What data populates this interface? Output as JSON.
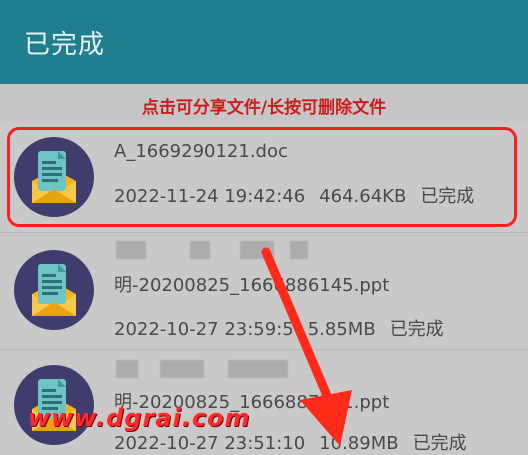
{
  "header": {
    "title": "已完成"
  },
  "hint": {
    "text": "点击可分享文件/长按可删除文件"
  },
  "files": [
    {
      "name": "A_1669290121.doc",
      "date": "2022-11-24 19:42:46",
      "size": "464.64KB",
      "status": "已完成"
    },
    {
      "name": "明-20200825_1666886145.ppt",
      "date": "2022-10-27 23:59:5",
      "size": "5.85MB",
      "status": "已完成"
    },
    {
      "name": "明-20200825_1666887191.ppt",
      "date": "2022-10-27 23:51:10",
      "size": "10.89MB",
      "status": "已完成"
    }
  ],
  "watermark": "www.dgrai.com",
  "colors": {
    "appbar": "#1f7f8f",
    "hint_text": "#c81e1e",
    "highlight": "#ff1e1e",
    "arrow": "#ff2a1a"
  },
  "icons": {
    "file": "document-envelope-icon"
  }
}
